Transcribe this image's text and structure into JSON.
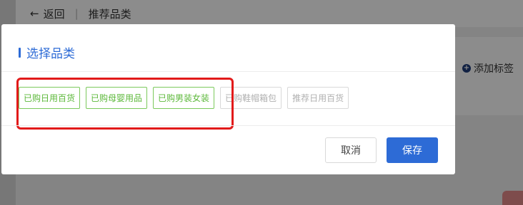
{
  "header": {
    "back_label": "返回",
    "separator": "|",
    "page_title": "推荐品类"
  },
  "background": {
    "add_tag_label": "添加标签"
  },
  "dialog": {
    "title": "选择品类",
    "tags": [
      {
        "label": "已购日用百货",
        "selected": true
      },
      {
        "label": "已购母婴用品",
        "selected": true
      },
      {
        "label": "已购男装女装",
        "selected": true
      },
      {
        "label": "已购鞋帽箱包",
        "selected": false
      },
      {
        "label": "推荐日用百货",
        "selected": false
      }
    ],
    "cancel_label": "取消",
    "save_label": "保存"
  },
  "colors": {
    "accent": "#2d6bd6",
    "selected_tag": "#5cb83a",
    "highlight": "#e21a1a"
  }
}
